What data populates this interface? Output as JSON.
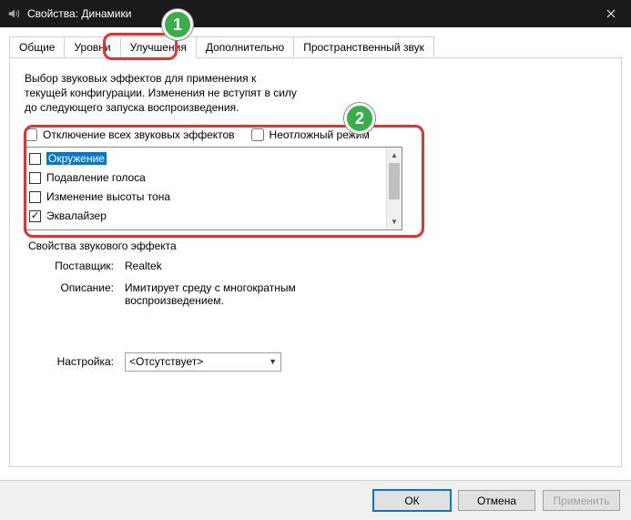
{
  "titlebar": {
    "title": "Свойства: Динамики"
  },
  "tabs": {
    "general": "Общие",
    "levels": "Уровни",
    "enhancements": "Улучшения",
    "advanced": "Дополнительно",
    "spatial": "Пространственный звук"
  },
  "intro": "Выбор звуковых эффектов для применения к текущей конфигурации. Изменения не вступят в силу до следующего запуска воспроизведения.",
  "checks": {
    "disable_all": "Отключение всех звуковых эффектов",
    "immediate": "Неотложный режим"
  },
  "effects": [
    {
      "label": "Окружение",
      "checked": false,
      "selected": true
    },
    {
      "label": "Подавление голоса",
      "checked": false,
      "selected": false
    },
    {
      "label": "Изменение высоты тона",
      "checked": false,
      "selected": false
    },
    {
      "label": "Эквалайзер",
      "checked": true,
      "selected": false
    }
  ],
  "group": {
    "title": "Свойства звукового эффекта",
    "provider_label": "Поставщик:",
    "provider_value": "Realtek",
    "desc_label": "Описание:",
    "desc_value": "Имитирует среду с многократным воспроизведением."
  },
  "settings": {
    "label": "Настройка:",
    "value": "<Отсутствует>"
  },
  "buttons": {
    "ok": "ОК",
    "cancel": "Отмена",
    "apply": "Применить"
  },
  "callouts": {
    "one": "1",
    "two": "2"
  }
}
